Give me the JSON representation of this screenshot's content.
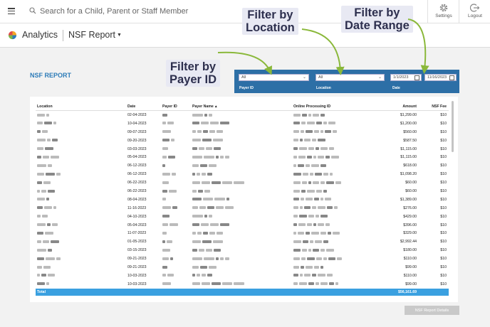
{
  "topbar": {
    "search_placeholder": "Search for a Child, Parent or Staff Member",
    "settings_label": "Settings",
    "logout_label": "Logout"
  },
  "subbar": {
    "app_name": "Analytics",
    "report_name": "NSF Report"
  },
  "report": {
    "title": "NSF REPORT",
    "details_button": "NSF Report Details"
  },
  "filters": {
    "payer_id": {
      "value": "All",
      "label": "Payer ID"
    },
    "location": {
      "value": "All",
      "label": "Location"
    },
    "date": {
      "start": "1/1/2023",
      "end": "11/16/2023",
      "label": "Date"
    }
  },
  "callouts": {
    "location": [
      "Filter by",
      "Location"
    ],
    "date_range": [
      "Filter by",
      "Date Range"
    ],
    "payer_id": [
      "Filter by",
      "Payer ID"
    ]
  },
  "table": {
    "columns": [
      "Location",
      "Date",
      "Payer ID",
      "Payer Name",
      "Online Processing ID",
      "Amount",
      "NSF Fee"
    ],
    "rows": [
      {
        "date": "02-04-2023",
        "amount": "$1,299.00",
        "fee": "$10"
      },
      {
        "date": "10-04-2023",
        "amount": "$1,200.00",
        "fee": "$10"
      },
      {
        "date": "09-07-2023",
        "amount": "$560.00",
        "fee": "$10"
      },
      {
        "date": "09-20-2023",
        "amount": "$587.50",
        "fee": "$10"
      },
      {
        "date": "03-03-2023",
        "amount": "$1,115.00",
        "fee": "$10"
      },
      {
        "date": "05-04-2023",
        "amount": "$1,115.00",
        "fee": "$10"
      },
      {
        "date": "06-12-2023",
        "amount": "$618.00",
        "fee": "$10"
      },
      {
        "date": "06-12-2023",
        "amount": "$1,098.20",
        "fee": "$10"
      },
      {
        "date": "06-22-2023",
        "amount": "$60.00",
        "fee": "$10"
      },
      {
        "date": "06-22-2023",
        "amount": "$60.00",
        "fee": "$10"
      },
      {
        "date": "08-04-2023",
        "amount": "$1,389.00",
        "fee": "$10"
      },
      {
        "date": "11-16-2023",
        "amount": "$276.00",
        "fee": "$10"
      },
      {
        "date": "04-10-2023",
        "amount": "$429.00",
        "fee": "$10"
      },
      {
        "date": "05-04-2023",
        "amount": "$396.00",
        "fee": "$10"
      },
      {
        "date": "11-07-2023",
        "amount": "$329.00",
        "fee": "$10"
      },
      {
        "date": "01-05-2023",
        "amount": "$2,992.44",
        "fee": "$10"
      },
      {
        "date": "03-15-2023",
        "amount": "$180.00",
        "fee": "$10"
      },
      {
        "date": "09-21-2023",
        "amount": "$110.00",
        "fee": "$10"
      },
      {
        "date": "09-21-2023",
        "amount": "$99.00",
        "fee": "$10"
      },
      {
        "date": "10-03-2023",
        "amount": "$110.00",
        "fee": "$10"
      },
      {
        "date": "10-03-2023",
        "amount": "$99.00",
        "fee": "$10"
      }
    ],
    "total_label": "Total",
    "total_amount": "$56,161.69"
  },
  "colors": {
    "filter_bar": "#2d6fa6",
    "total_row": "#3aa0e0",
    "title": "#2e7cb8",
    "callout_arrow": "#8ab83a"
  },
  "icons": [
    "menu-icon",
    "search-icon",
    "gear-icon",
    "logout-icon",
    "analytics-logo-icon",
    "chevron-down-icon",
    "calendar-icon"
  ]
}
